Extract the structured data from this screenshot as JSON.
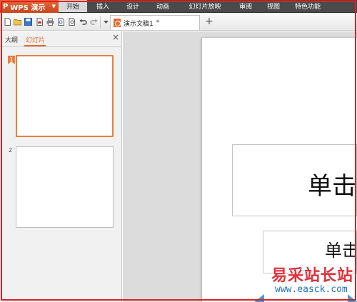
{
  "app": {
    "name": "WPS 演示",
    "logo": "P",
    "accent_color": "#e46b2f"
  },
  "menu": {
    "tabs": [
      {
        "label": "开始",
        "active": true
      },
      {
        "label": "插入"
      },
      {
        "label": "设计"
      },
      {
        "label": "动画"
      },
      {
        "label": "幻灯片放映"
      },
      {
        "label": "审阅"
      },
      {
        "label": "视图"
      },
      {
        "label": "特色功能"
      }
    ]
  },
  "toolbar": {
    "icons": [
      "new-file-icon",
      "open-folder-icon",
      "save-icon",
      "pdf-export-icon",
      "print-icon",
      "print-preview-icon",
      "find-icon",
      "undo-icon",
      "redo-icon",
      "dropdown-icon"
    ]
  },
  "document": {
    "tab_title": "演示文稿1",
    "modified_marker": "*",
    "new_tab": "+"
  },
  "left_pane": {
    "tab_outline": "大纲",
    "tab_slides": "幻灯片",
    "close": "×",
    "slides": [
      {
        "number": "1",
        "selected": true
      },
      {
        "number": "2",
        "selected": false
      }
    ]
  },
  "slide": {
    "title_placeholder": "单击",
    "subtitle_placeholder": "单击"
  },
  "watermark": {
    "cn": "易采站长站",
    "en": "www.easck.com"
  }
}
